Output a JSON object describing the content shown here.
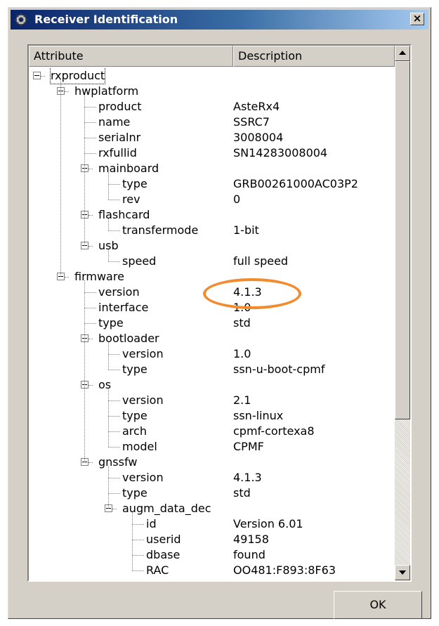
{
  "window": {
    "title": "Receiver Identification",
    "close_label": "×"
  },
  "table": {
    "columns": [
      "Attribute",
      "Description"
    ],
    "rows": [
      {
        "label": "rxproduct",
        "value": "",
        "level": 0,
        "expandable": true
      },
      {
        "label": "hwplatform",
        "value": "",
        "level": 1,
        "expandable": true
      },
      {
        "label": "product",
        "value": "AsteRx4",
        "level": 2,
        "expandable": false
      },
      {
        "label": "name",
        "value": "SSRC7",
        "level": 2,
        "expandable": false
      },
      {
        "label": "serialnr",
        "value": "3008004",
        "level": 2,
        "expandable": false
      },
      {
        "label": "rxfullid",
        "value": "SN14283008004",
        "level": 2,
        "expandable": false
      },
      {
        "label": "mainboard",
        "value": "",
        "level": 2,
        "expandable": true
      },
      {
        "label": "type",
        "value": "GRB00261000AC03P2",
        "level": 3,
        "expandable": false
      },
      {
        "label": "rev",
        "value": "0",
        "level": 3,
        "expandable": false
      },
      {
        "label": "flashcard",
        "value": "",
        "level": 2,
        "expandable": true
      },
      {
        "label": "transfermode",
        "value": "1-bit",
        "level": 3,
        "expandable": false
      },
      {
        "label": "usb",
        "value": "",
        "level": 2,
        "expandable": true
      },
      {
        "label": "speed",
        "value": "full speed",
        "level": 3,
        "expandable": false
      },
      {
        "label": "firmware",
        "value": "",
        "level": 1,
        "expandable": true
      },
      {
        "label": "version",
        "value": "4.1.3",
        "level": 2,
        "expandable": false
      },
      {
        "label": "interface",
        "value": "1.0",
        "level": 2,
        "expandable": false
      },
      {
        "label": "type",
        "value": "std",
        "level": 2,
        "expandable": false
      },
      {
        "label": "bootloader",
        "value": "",
        "level": 2,
        "expandable": true
      },
      {
        "label": "version",
        "value": "1.0",
        "level": 3,
        "expandable": false
      },
      {
        "label": "type",
        "value": "ssn-u-boot-cpmf",
        "level": 3,
        "expandable": false
      },
      {
        "label": "os",
        "value": "",
        "level": 2,
        "expandable": true
      },
      {
        "label": "version",
        "value": "2.1",
        "level": 3,
        "expandable": false
      },
      {
        "label": "type",
        "value": "ssn-linux",
        "level": 3,
        "expandable": false
      },
      {
        "label": "arch",
        "value": "cpmf-cortexa8",
        "level": 3,
        "expandable": false
      },
      {
        "label": "model",
        "value": "CPMF",
        "level": 3,
        "expandable": false
      },
      {
        "label": "gnssfw",
        "value": "",
        "level": 2,
        "expandable": true
      },
      {
        "label": "version",
        "value": "4.1.3",
        "level": 3,
        "expandable": false
      },
      {
        "label": "type",
        "value": "std",
        "level": 3,
        "expandable": false
      },
      {
        "label": "augm_data_dec",
        "value": "",
        "level": 3,
        "expandable": true
      },
      {
        "label": "id",
        "value": "Version 6.01",
        "level": 4,
        "expandable": false
      },
      {
        "label": "userid",
        "value": "49158",
        "level": 4,
        "expandable": false
      },
      {
        "label": "dbase",
        "value": "found",
        "level": 4,
        "expandable": false
      },
      {
        "label": "RAC",
        "value": "OO481:F893:8F63",
        "level": 4,
        "expandable": false
      }
    ]
  },
  "annotation": {
    "color": "#f28a2e"
  },
  "ok_button": {
    "label": "OK"
  }
}
